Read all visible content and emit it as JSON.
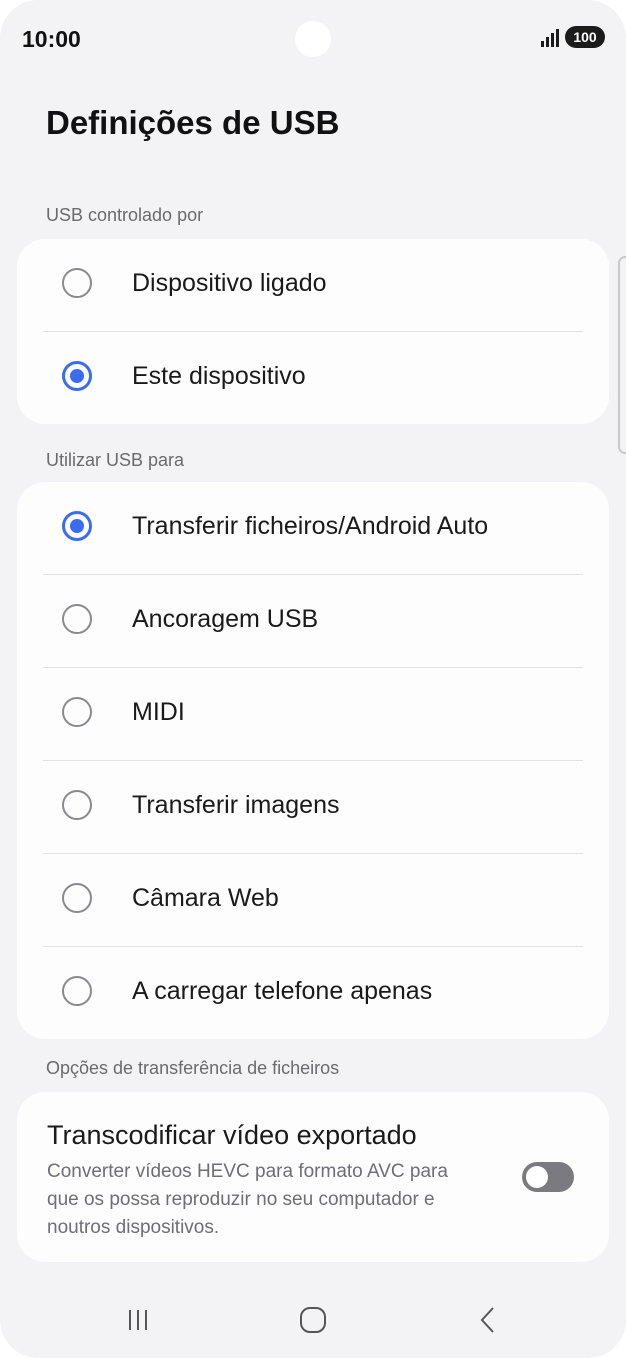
{
  "status_bar": {
    "time": "10:00",
    "battery": "100"
  },
  "page": {
    "title": "Definições de USB"
  },
  "controlled_by": {
    "header": "USB controlado por",
    "options": [
      {
        "label": "Dispositivo ligado",
        "selected": false
      },
      {
        "label": "Este dispositivo",
        "selected": true
      }
    ]
  },
  "use_usb_for": {
    "header": "Utilizar USB para",
    "options": [
      {
        "label": "Transferir ficheiros/Android Auto",
        "selected": true
      },
      {
        "label": "Ancoragem USB",
        "selected": false
      },
      {
        "label": "MIDI",
        "selected": false
      },
      {
        "label": "Transferir imagens",
        "selected": false
      },
      {
        "label": "Câmara Web",
        "selected": false
      },
      {
        "label": "A carregar telefone apenas",
        "selected": false
      }
    ]
  },
  "file_transfer_options": {
    "header": "Opções de transferência de ficheiros",
    "transcode": {
      "title": "Transcodificar vídeo exportado",
      "description": "Converter vídeos HEVC para formato AVC para que os possa reproduzir no seu computador e noutros dispositivos.",
      "enabled": false
    }
  },
  "nav_bar": {
    "recents": "recents-icon",
    "home": "home-icon",
    "back": "back-icon"
  },
  "colors": {
    "accent": "#3b6cf0",
    "background": "#f3f3f5",
    "card": "#fdfdfe"
  }
}
